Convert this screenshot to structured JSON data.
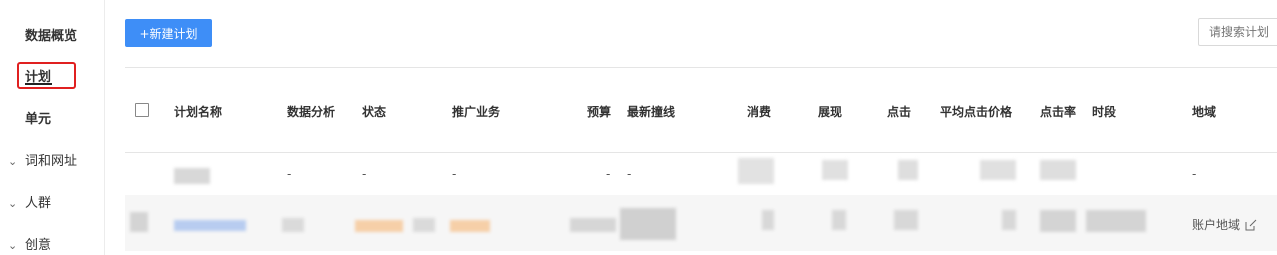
{
  "sidebar": {
    "items": [
      {
        "label": "数据概览"
      },
      {
        "label": "计划"
      },
      {
        "label": "单元"
      }
    ],
    "groups": [
      {
        "label": "词和网址",
        "chevron": "chevron-down-icon"
      },
      {
        "label": "人群",
        "chevron": "chevron-down-icon"
      },
      {
        "label": "创意",
        "chevron": "chevron-down-icon"
      }
    ]
  },
  "toolbar": {
    "new_plan_label": "+新建计划",
    "search_placeholder": "请搜索计划"
  },
  "table": {
    "headers": {
      "name": "计划名称",
      "analysis": "数据分析",
      "status": "状态",
      "business": "推广业务",
      "budget": "预算",
      "latest": "最新撞线",
      "cost": "消费",
      "impressions": "展现",
      "clicks": "点击",
      "avg_cpc": "平均点击价格",
      "ctr": "点击率",
      "schedule": "时段",
      "region": "地域"
    },
    "row1": {
      "analysis": "-",
      "status": "-",
      "business": "-",
      "budget": "-",
      "latest": "-",
      "region": "-"
    },
    "row2": {
      "region_link": "账户地域"
    }
  },
  "colors": {
    "accent": "#3e8ef7",
    "highlight": "#e02020"
  }
}
